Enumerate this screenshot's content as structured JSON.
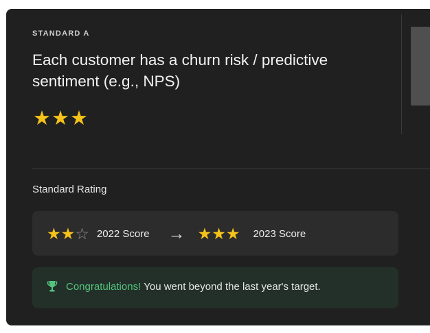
{
  "standard": {
    "eyebrow": "STANDARD A",
    "title": "Each customer has a churn risk / predictive sentiment (e.g., NPS)",
    "stars": "★★★",
    "rating": 3,
    "rating_max": 3
  },
  "rating_section": {
    "label": "Standard Rating",
    "previous": {
      "stars_filled": "★★",
      "stars_empty": "☆",
      "rating": 2,
      "rating_max": 3,
      "label": "2022 Score"
    },
    "arrow": "→",
    "current": {
      "stars_filled": "★★★",
      "rating": 3,
      "rating_max": 3,
      "label": "2023 Score"
    }
  },
  "congrats": {
    "icon": "trophy-icon",
    "highlight": "Congratulations!",
    "message": "You went beyond the last year's target."
  },
  "colors": {
    "background": "#202020",
    "star": "#f6c31a",
    "success": "#54c47c",
    "success_panel": "#23302a"
  }
}
